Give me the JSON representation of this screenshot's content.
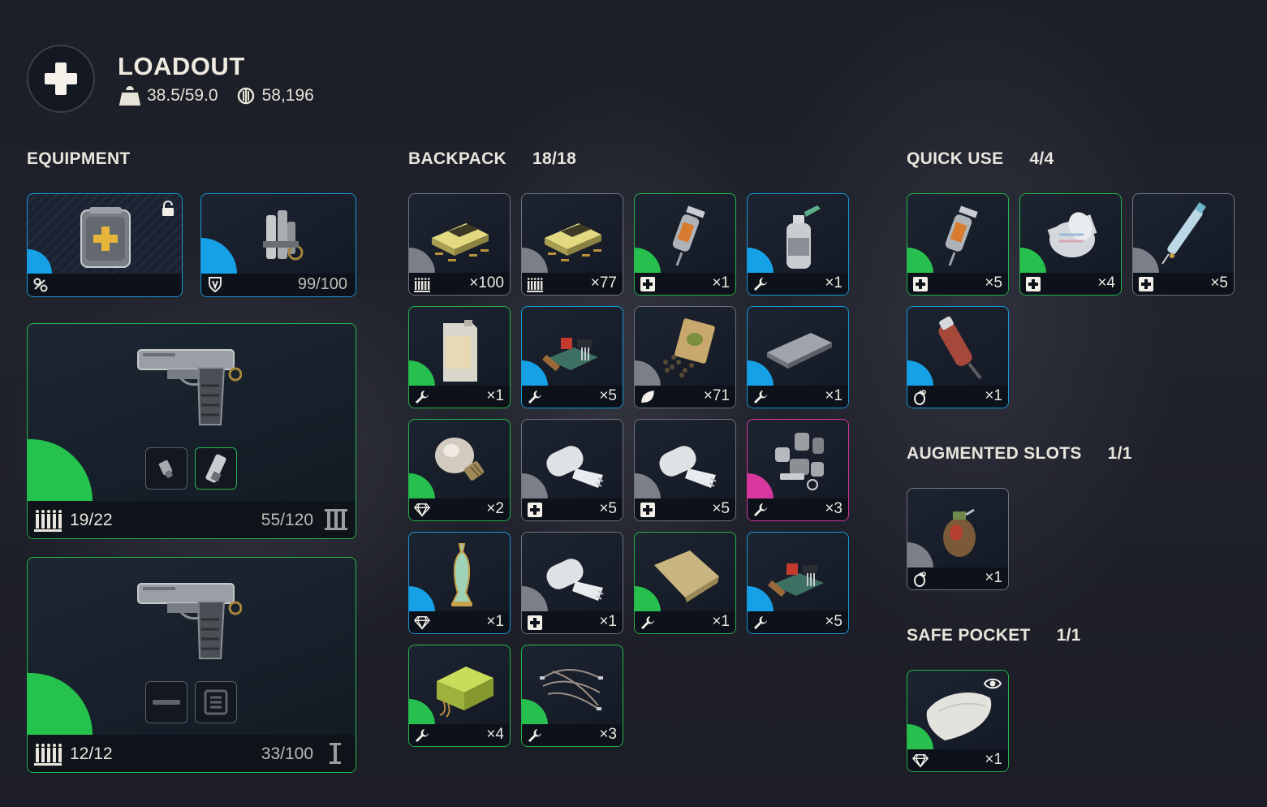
{
  "header": {
    "title": "LOADOUT",
    "weight": "38.5/59.0",
    "currency": "58,196"
  },
  "equipment": {
    "title": "EQUIPMENT",
    "augment_icon": "augment-icon",
    "shield_value": "99/100",
    "weapons": [
      {
        "ammo": "19/22",
        "durability": "55/120",
        "tier_icon": "tier-3-icon"
      },
      {
        "ammo": "12/12",
        "durability": "33/100",
        "tier_icon": "tier-1-icon"
      }
    ]
  },
  "backpack": {
    "title": "BACKPACK",
    "count": "18/18",
    "items": [
      {
        "qty": "×100",
        "rarity": "grey",
        "tag": "ammo-icon",
        "art": "ammo-box"
      },
      {
        "qty": "×77",
        "rarity": "grey",
        "tag": "ammo-icon",
        "art": "ammo-box"
      },
      {
        "qty": "×1",
        "rarity": "green",
        "tag": "medical-icon",
        "art": "injector"
      },
      {
        "qty": "×1",
        "rarity": "blue",
        "tag": "wrench-icon",
        "art": "spray-bottle"
      },
      {
        "qty": "×1",
        "rarity": "green",
        "tag": "wrench-icon",
        "art": "canister"
      },
      {
        "qty": "×5",
        "rarity": "blue",
        "tag": "wrench-icon",
        "art": "electronics"
      },
      {
        "qty": "×71",
        "rarity": "grey",
        "tag": "leaf-icon",
        "art": "seeds"
      },
      {
        "qty": "×1",
        "rarity": "blue",
        "tag": "wrench-icon",
        "art": "power-bank"
      },
      {
        "qty": "×2",
        "rarity": "green",
        "tag": "valuable-icon",
        "art": "light-bulb"
      },
      {
        "qty": "×5",
        "rarity": "grey",
        "tag": "medical-icon",
        "art": "bandage"
      },
      {
        "qty": "×5",
        "rarity": "grey",
        "tag": "medical-icon",
        "art": "bandage"
      },
      {
        "qty": "×3",
        "rarity": "pink",
        "tag": "wrench-icon",
        "art": "mechanical-parts"
      },
      {
        "qty": "×1",
        "rarity": "blue",
        "tag": "valuable-icon",
        "art": "vase"
      },
      {
        "qty": "×1",
        "rarity": "grey",
        "tag": "medical-icon",
        "art": "bandage"
      },
      {
        "qty": "×1",
        "rarity": "green",
        "tag": "wrench-icon",
        "art": "cloth"
      },
      {
        "qty": "×5",
        "rarity": "blue",
        "tag": "wrench-icon",
        "art": "electronics"
      },
      {
        "qty": "×4",
        "rarity": "green",
        "tag": "wrench-icon",
        "art": "battery"
      },
      {
        "qty": "×3",
        "rarity": "green",
        "tag": "wrench-icon",
        "art": "wires"
      }
    ]
  },
  "quick_use": {
    "title": "QUICK USE",
    "count": "4/4",
    "items": [
      {
        "qty": "×5",
        "rarity": "green",
        "tag": "medical-icon",
        "art": "injector"
      },
      {
        "qty": "×4",
        "rarity": "green",
        "tag": "medical-icon",
        "art": "bandage-roll"
      },
      {
        "qty": "×5",
        "rarity": "grey",
        "tag": "medical-icon",
        "art": "syringe"
      },
      {
        "qty": "×1",
        "rarity": "blue",
        "tag": "grenade-icon",
        "art": "flare"
      }
    ]
  },
  "augmented": {
    "title": "AUGMENTED SLOTS",
    "count": "1/1",
    "items": [
      {
        "qty": "×1",
        "rarity": "grey",
        "tag": "grenade-icon",
        "art": "grenade"
      }
    ]
  },
  "safe_pocket": {
    "title": "SAFE POCKET",
    "count": "1/1",
    "items": [
      {
        "qty": "×1",
        "rarity": "green",
        "tag": "valuable-icon",
        "art": "pillow"
      }
    ]
  },
  "colors": {
    "grey": "#7b7f87",
    "green": "#27c04f",
    "blue": "#16a0e6",
    "pink": "#d8389e"
  }
}
